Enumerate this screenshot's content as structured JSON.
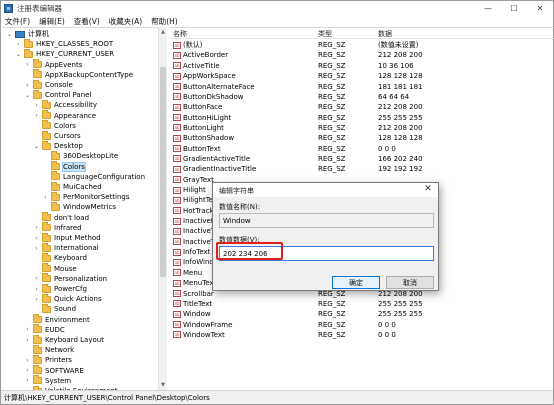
{
  "window": {
    "title": "注册表编辑器",
    "controls": {
      "minimize": "—",
      "maximize": "☐",
      "close": "✕"
    }
  },
  "menu": [
    "文件(F)",
    "编辑(E)",
    "查看(V)",
    "收藏夹(A)",
    "帮助(H)"
  ],
  "tree": [
    {
      "label": "计算机",
      "depth": 0,
      "expander": "open",
      "icon": "computer-icon"
    },
    {
      "label": "HKEY_CLASSES_ROOT",
      "depth": 1,
      "expander": "closed"
    },
    {
      "label": "HKEY_CURRENT_USER",
      "depth": 1,
      "expander": "open"
    },
    {
      "label": "AppEvents",
      "depth": 2,
      "expander": "closed"
    },
    {
      "label": "AppXBackupContentType",
      "depth": 2,
      "expander": "none"
    },
    {
      "label": "Console",
      "depth": 2,
      "expander": "closed"
    },
    {
      "label": "Control Panel",
      "depth": 2,
      "expander": "open"
    },
    {
      "label": "Accessibility",
      "depth": 3,
      "expander": "closed"
    },
    {
      "label": "Appearance",
      "depth": 3,
      "expander": "closed"
    },
    {
      "label": "Colors",
      "depth": 3,
      "expander": "none"
    },
    {
      "label": "Cursors",
      "depth": 3,
      "expander": "none"
    },
    {
      "label": "Desktop",
      "depth": 3,
      "expander": "open"
    },
    {
      "label": "360DesktopLite",
      "depth": 4,
      "expander": "none"
    },
    {
      "label": "Colors",
      "depth": 4,
      "expander": "none",
      "selected": true
    },
    {
      "label": "LanguageConfiguration",
      "depth": 4,
      "expander": "none"
    },
    {
      "label": "MuiCached",
      "depth": 4,
      "expander": "none"
    },
    {
      "label": "PerMonitorSettings",
      "depth": 4,
      "expander": "closed"
    },
    {
      "label": "WindowMetrics",
      "depth": 4,
      "expander": "none"
    },
    {
      "label": "don't load",
      "depth": 3,
      "expander": "none"
    },
    {
      "label": "Infrared",
      "depth": 3,
      "expander": "closed"
    },
    {
      "label": "Input Method",
      "depth": 3,
      "expander": "closed"
    },
    {
      "label": "International",
      "depth": 3,
      "expander": "closed"
    },
    {
      "label": "Keyboard",
      "depth": 3,
      "expander": "none"
    },
    {
      "label": "Mouse",
      "depth": 3,
      "expander": "none"
    },
    {
      "label": "Personalization",
      "depth": 3,
      "expander": "closed"
    },
    {
      "label": "PowerCfg",
      "depth": 3,
      "expander": "closed"
    },
    {
      "label": "Quick Actions",
      "depth": 3,
      "expander": "closed"
    },
    {
      "label": "Sound",
      "depth": 3,
      "expander": "none"
    },
    {
      "label": "Environment",
      "depth": 2,
      "expander": "none"
    },
    {
      "label": "EUDC",
      "depth": 2,
      "expander": "closed"
    },
    {
      "label": "Keyboard Layout",
      "depth": 2,
      "expander": "closed"
    },
    {
      "label": "Network",
      "depth": 2,
      "expander": "none"
    },
    {
      "label": "Printers",
      "depth": 2,
      "expander": "closed"
    },
    {
      "label": "SOFTWARE",
      "depth": 2,
      "expander": "closed"
    },
    {
      "label": "System",
      "depth": 2,
      "expander": "closed"
    },
    {
      "label": "Volatile Environment",
      "depth": 2,
      "expander": "closed"
    }
  ],
  "list": {
    "headers": {
      "name": "名称",
      "type": "类型",
      "data": "数据"
    },
    "rows": [
      {
        "name": "(默认)",
        "type": "REG_SZ",
        "data": "(数值未设置)"
      },
      {
        "name": "ActiveBorder",
        "type": "REG_SZ",
        "data": "212 208 200"
      },
      {
        "name": "ActiveTitle",
        "type": "REG_SZ",
        "data": "10 36 106"
      },
      {
        "name": "AppWorkSpace",
        "type": "REG_SZ",
        "data": "128 128 128"
      },
      {
        "name": "ButtonAlternateFace",
        "type": "REG_SZ",
        "data": "181 181 181"
      },
      {
        "name": "ButtonDkShadow",
        "type": "REG_SZ",
        "data": "64 64 64"
      },
      {
        "name": "ButtonFace",
        "type": "REG_SZ",
        "data": "212 208 200"
      },
      {
        "name": "ButtonHiLight",
        "type": "REG_SZ",
        "data": "255 255 255"
      },
      {
        "name": "ButtonLight",
        "type": "REG_SZ",
        "data": "212 208 200"
      },
      {
        "name": "ButtonShadow",
        "type": "REG_SZ",
        "data": "128 128 128"
      },
      {
        "name": "ButtonText",
        "type": "REG_SZ",
        "data": "0 0 0"
      },
      {
        "name": "GradientActiveTitle",
        "type": "REG_SZ",
        "data": "166 202 240"
      },
      {
        "name": "GradientInactiveTitle",
        "type": "REG_SZ",
        "data": "192 192 192"
      },
      {
        "name": "GrayText",
        "type": "",
        "data": ""
      },
      {
        "name": "Hilight",
        "type": "",
        "data": ""
      },
      {
        "name": "HilightText",
        "type": "",
        "data": ""
      },
      {
        "name": "HotTracking",
        "type": "",
        "data": ""
      },
      {
        "name": "InactiveBo",
        "type": "",
        "data": ""
      },
      {
        "name": "InactiveTit",
        "type": "",
        "data": ""
      },
      {
        "name": "InactiveTit",
        "type": "",
        "data": ""
      },
      {
        "name": "InfoText",
        "type": "",
        "data": ""
      },
      {
        "name": "InfoWindo",
        "type": "",
        "data": ""
      },
      {
        "name": "Menu",
        "type": "",
        "data": ""
      },
      {
        "name": "MenuText",
        "type": "REG_SZ",
        "data": "0 0 0"
      },
      {
        "name": "Scrollbar",
        "type": "REG_SZ",
        "data": "212 208 200"
      },
      {
        "name": "TitleText",
        "type": "REG_SZ",
        "data": "255 255 255"
      },
      {
        "name": "Window",
        "type": "REG_SZ",
        "data": "255 255 255"
      },
      {
        "name": "WindowFrame",
        "type": "REG_SZ",
        "data": "0 0 0"
      },
      {
        "name": "WindowText",
        "type": "REG_SZ",
        "data": "0 0 0"
      }
    ]
  },
  "status": {
    "path": "计算机\\HKEY_CURRENT_USER\\Control Panel\\Desktop\\Colors"
  },
  "dialog": {
    "title": "编辑字符串",
    "close": "✕",
    "name_label": "数值名称(N):",
    "name_value": "Window",
    "data_label": "数值数据(V):",
    "data_value": "202 234 206",
    "ok": "确定",
    "cancel": "取消",
    "highlight_color": "#e01f1f"
  }
}
